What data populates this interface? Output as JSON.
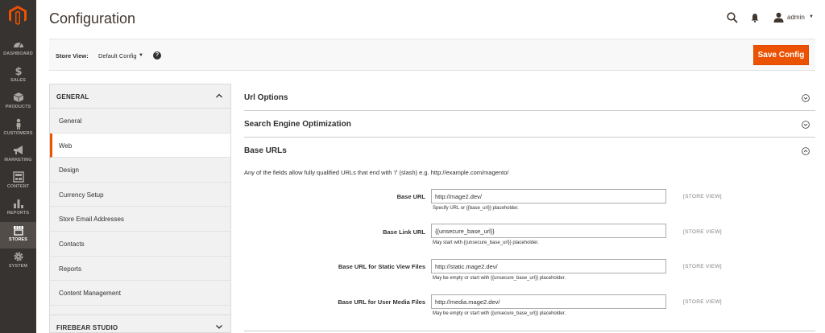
{
  "sidebar": {
    "items": [
      {
        "label": "DASHBOARD",
        "icon": "dashboard-icon"
      },
      {
        "label": "SALES",
        "icon": "dollar-icon"
      },
      {
        "label": "PRODUCTS",
        "icon": "cube-icon"
      },
      {
        "label": "CUSTOMERS",
        "icon": "person-icon"
      },
      {
        "label": "MARKETING",
        "icon": "megaphone-icon"
      },
      {
        "label": "CONTENT",
        "icon": "layout-icon"
      },
      {
        "label": "REPORTS",
        "icon": "bar-chart-icon"
      },
      {
        "label": "STORES",
        "icon": "store-icon",
        "active": true
      },
      {
        "label": "SYSTEM",
        "icon": "gear-icon"
      }
    ]
  },
  "header": {
    "title": "Configuration",
    "user": "admin"
  },
  "store_view": {
    "label": "Store View:",
    "value": "Default Config"
  },
  "toolbar": {
    "save_label": "Save Config"
  },
  "config_tabs": {
    "groups": [
      {
        "title": "GENERAL",
        "expanded": true
      },
      {
        "title": "FIREBEAR STUDIO",
        "expanded": false
      }
    ],
    "items": [
      "General",
      "Web",
      "Design",
      "Currency Setup",
      "Store Email Addresses",
      "Contacts",
      "Reports",
      "Content Management"
    ],
    "active": "Web"
  },
  "sections": [
    {
      "title": "Url Options",
      "expanded": false
    },
    {
      "title": "Search Engine Optimization",
      "expanded": false
    },
    {
      "title": "Base URLs",
      "expanded": true
    }
  ],
  "base_urls": {
    "hint": "Any of the fields allow fully qualified URLs that end with '/' (slash) e.g. http://example.com/magento/",
    "fields": [
      {
        "label": "Base URL",
        "value": "http://mage2.dev/",
        "note": "Specify URL or {{base_url}} placeholder.",
        "scope": "[STORE VIEW]"
      },
      {
        "label": "Base Link URL",
        "value": "{{unsecure_base_url}}",
        "note": "May start with {{unsecure_base_url}} placeholder.",
        "scope": "[STORE VIEW]"
      },
      {
        "label": "Base URL for Static View Files",
        "value": "http://static.mage2.dev/",
        "note": "May be empty or start with {{unsecure_base_url}} placeholder.",
        "scope": "[STORE VIEW]"
      },
      {
        "label": "Base URL for User Media Files",
        "value": "http://media.mage2.dev/",
        "note": "May be empty or start with {{unsecure_base_url}} placeholder.",
        "scope": "[STORE VIEW]"
      }
    ]
  },
  "colors": {
    "accent": "#eb5202",
    "sidebar": "#373330"
  }
}
